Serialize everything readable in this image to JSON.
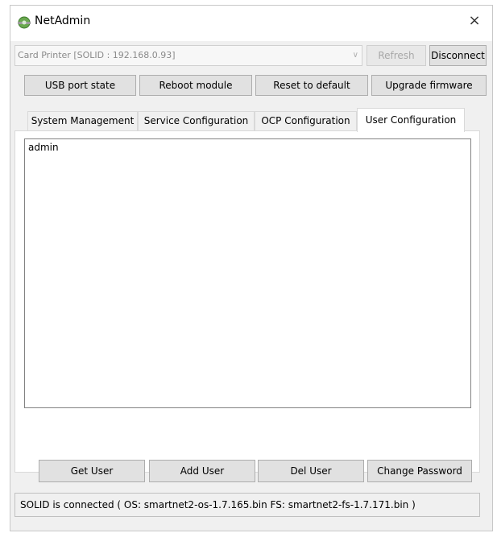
{
  "window": {
    "title": "NetAdmin",
    "close_glyph": "×",
    "icon": "netadmin-app-icon"
  },
  "connection": {
    "device_select_value": "Card Printer  [SOLID : 192.168.0.93]",
    "dropdown_glyph": "∨",
    "refresh_label": "Refresh",
    "disconnect_label": "Disconnect"
  },
  "toolbar": {
    "usb_label": "USB port state",
    "reboot_label": "Reboot module",
    "reset_label": "Reset to default",
    "upgrade_label": "Upgrade firmware"
  },
  "tabs": [
    {
      "label": "System Management",
      "active": false
    },
    {
      "label": "Service Configuration",
      "active": false
    },
    {
      "label": "OCP Configuration",
      "active": false
    },
    {
      "label": "User Configuration",
      "active": true
    }
  ],
  "user_config": {
    "users": [
      "admin"
    ],
    "get_user_label": "Get User",
    "add_user_label": "Add User",
    "del_user_label": "Del User",
    "change_password_label": "Change Password"
  },
  "status": {
    "text": "SOLID is connected ( OS: smartnet2-os-1.7.165.bin  FS: smartnet2-fs-1.7.171.bin )"
  }
}
